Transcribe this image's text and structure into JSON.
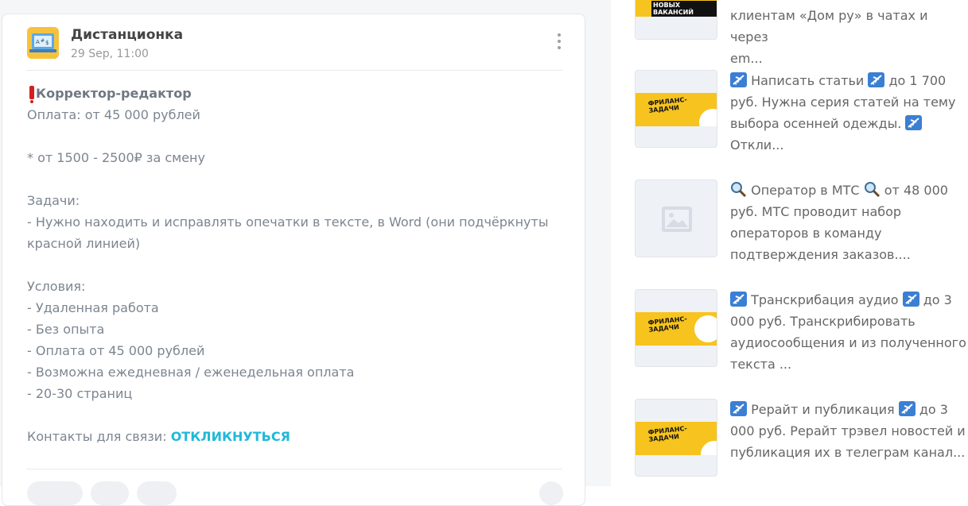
{
  "post": {
    "channel": "Дистанционка",
    "date": "29 Sep, 11:00",
    "title": "Корректор-редактор",
    "lines": [
      "Оплата: от 45 000 рублей",
      "",
      "* от 1500 - 2500₽ за смену",
      "",
      "Задачи:",
      "- Нужно находить и исправлять опечатки в тексте, в Word (они подчёркнуты",
      "красной линией)",
      "",
      "Условия:",
      "- Удаленная работа",
      "- Без опыта",
      "- Оплата от 45 000 рублей",
      "- Возможна ежедневная / еженедельная оплата",
      "- 20-30 страниц",
      ""
    ],
    "contacts_label": "Контакты для связи:",
    "contacts_link": "ОТКЛИКНУТЬСЯ",
    "warning_icon": "exclamation-icon",
    "link_color": "#20b9d8"
  },
  "sidebar": {
    "items": [
      {
        "line1": "клиентам «Дом ру» в чатах и через",
        "line2": "em...",
        "thumb": "banner-vacancies"
      },
      {
        "l1_a": "Написать статьи",
        "l1_b": "до 1 700",
        "line2": "руб. Нужна серия статей на тему",
        "line3": "выбора осенней одежды.",
        "line4": "Откли...",
        "thumb": "banner-freelance",
        "banner_text": "ФРИЛАНС-ЗАДАЧИ",
        "icon": "airplane-icon"
      },
      {
        "l1_a": "Оператор в МТС",
        "l1_b": "от 48 000",
        "line2": "руб. МТС проводит набор",
        "line3": "операторов в команду",
        "line4": "подтверждения заказов....",
        "thumb": "image-placeholder",
        "icon": "magnifier-icon"
      },
      {
        "l1_a": "Транскрибация аудио",
        "l1_b": "до 3",
        "line2": "000 руб. Транскрибировать",
        "line3": "аудиосообщения и из полученного",
        "line4": "текста ...",
        "thumb": "banner-freelance",
        "banner_text": "ФРИЛАНС-ЗАДАЧИ",
        "icon": "airplane-icon"
      },
      {
        "l1_a": "Рерайт и публикация",
        "l1_b": "до 3",
        "line2": "000 руб. Рерайт трэвел новостей и",
        "line3": "публикация их в телеграм канал...",
        "thumb": "banner-freelance",
        "banner_text": "ФРИЛАНС-ЗАДАЧИ",
        "icon": "airplane-icon"
      }
    ],
    "banner_top_text": "НОВЫХ ВАКАНСИЙ",
    "banner_color": "#f7c31e"
  }
}
